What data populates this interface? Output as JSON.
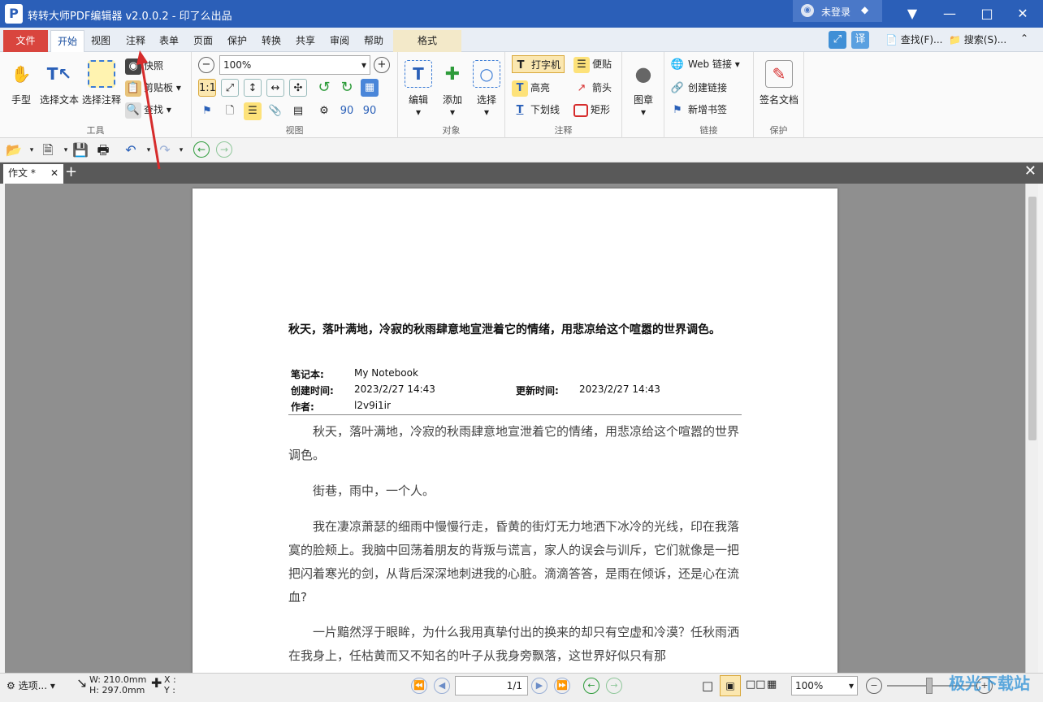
{
  "app": {
    "title": "转转大师PDF编辑器 v2.0.0.2 - 印了么出品",
    "logo": "P",
    "login_label": "未登录"
  },
  "menu": {
    "file": "文件",
    "tabs": [
      "开始",
      "视图",
      "注释",
      "表单",
      "页面",
      "保护",
      "转换",
      "共享",
      "审阅",
      "帮助"
    ],
    "format_tab": "格式",
    "find": "查找(F)...",
    "search": "搜索(S)..."
  },
  "ribbon": {
    "tools": {
      "hand": "手型",
      "select_text": "选择文本",
      "select_annot": "选择注释",
      "snapshot": "快照",
      "clipboard": "剪贴板",
      "find": "查找",
      "label": "工具"
    },
    "view": {
      "zoom": "100%",
      "label": "视图"
    },
    "objects": {
      "edit": "编辑",
      "add": "添加",
      "select": "选择",
      "label": "对象"
    },
    "annot": {
      "typewriter": "打字机",
      "note": "便贴",
      "highlight": "高亮",
      "arrow": "箭头",
      "underline": "下划线",
      "rect": "矩形",
      "label": "注释"
    },
    "stamp": {
      "label": "图章"
    },
    "links": {
      "web": "Web 链接",
      "create": "创建链接",
      "bookmark": "新增书签",
      "label": "链接"
    },
    "protect": {
      "sign": "签名文档",
      "label": "保护"
    }
  },
  "doc_tab": {
    "name": "作文 *"
  },
  "document": {
    "title": "秋天，落叶满地，冷寂的秋雨肆意地宣泄着它的情绪，用悲凉给这个喧嚣的世界调色。",
    "meta": {
      "notebook_label": "笔记本:",
      "notebook": "My Notebook",
      "created_label": "创建时间:",
      "created": "2023/2/27 14:43",
      "updated_label": "更新时间:",
      "updated": "2023/2/27 14:43",
      "author_label": "作者:",
      "author": "l2v9i1ir"
    },
    "paragraphs": [
      "秋天，落叶满地，冷寂的秋雨肆意地宣泄着它的情绪，用悲凉给这个喧嚣的世界调色。",
      "街巷，雨中，一个人。",
      "我在凄凉萧瑟的细雨中慢慢行走，昏黄的街灯无力地洒下冰冷的光线，印在我落寞的脸颊上。我脑中回荡着朋友的背叛与谎言，家人的误会与训斥，它们就像是一把把闪着寒光的剑，从背后深深地刺进我的心脏。滴滴答答，是雨在倾诉，还是心在流血?",
      "一片黯然浮于眼眸，为什么我用真挚付出的换来的却只有空虚和冷漠？任秋雨洒在我身上，任枯黄而又不知名的叶子从我身旁飘落，这世界好似只有那"
    ]
  },
  "status": {
    "options": "选项...",
    "w": "W: 210.0mm",
    "h": "H: 297.0mm",
    "x": "X :",
    "y": "Y :",
    "page": "1/1",
    "zoom": "100%",
    "watermark": "极光下载站"
  },
  "colors": {
    "titlebar": "#2b5fb8",
    "file_tab": "#d9453e",
    "arrow": "#d62c2c"
  }
}
